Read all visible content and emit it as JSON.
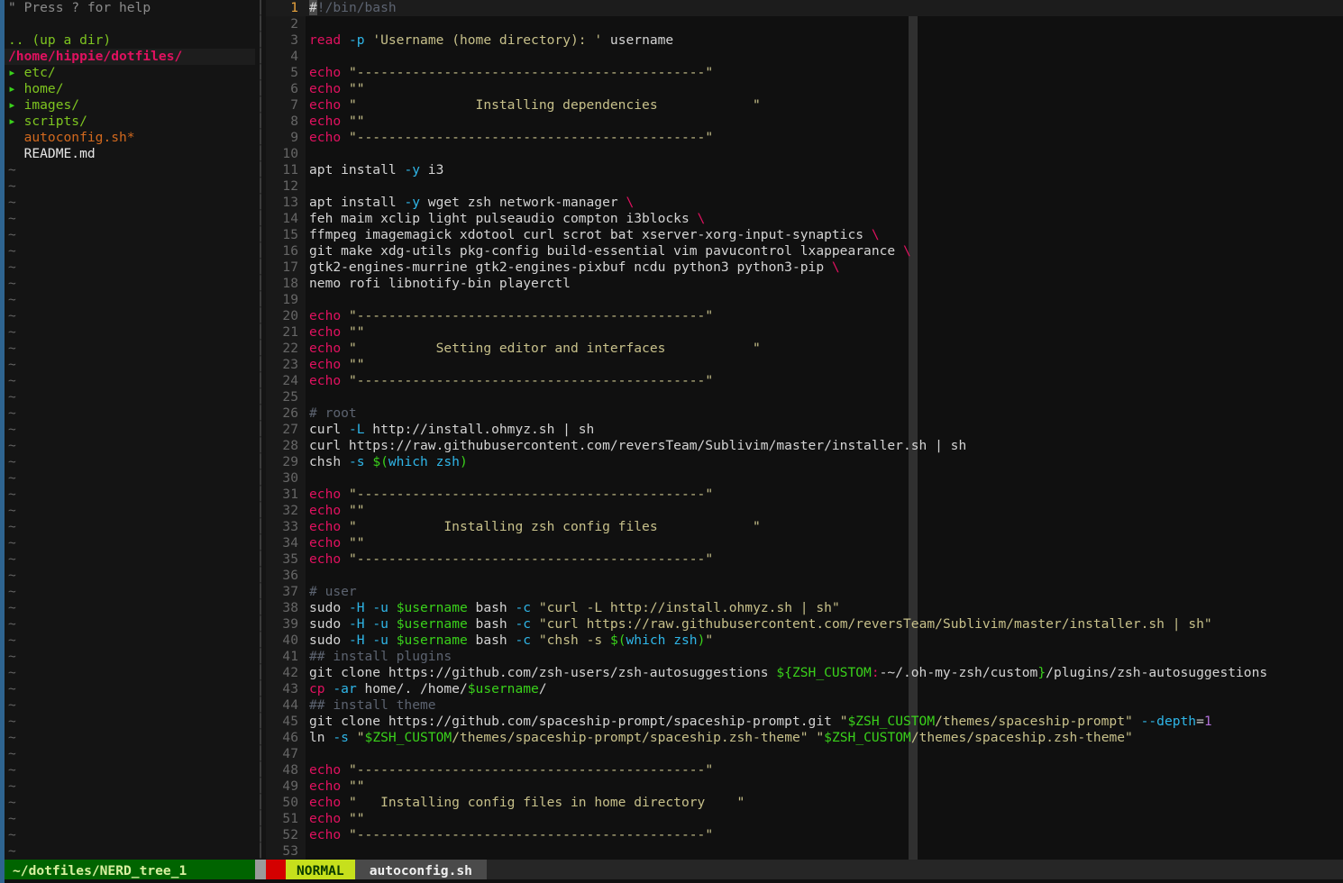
{
  "app": {
    "name": "vim",
    "colors": {
      "background": "#101010",
      "gutter_bg": "#191919",
      "cursorline_bg": "#1c1c1c",
      "colorcolumn": "#303030",
      "keyword_pink": "#e0115f",
      "string_khaki": "#c7c08a",
      "variable_green": "#3ad11b",
      "option_blue": "#2fb6e8",
      "comment_grey": "#5c6370",
      "number_purple": "#b06fd8",
      "status_mode_bg": "#c6e01c",
      "status_nerd_bg": "#006400",
      "window_border_blue": "#2e6490"
    }
  },
  "nerdtree": {
    "help_hint": "\" Press ? for help",
    "blank": "",
    "up_dir": ".. (up a dir)",
    "cwd": "/home/hippie/dotfiles/",
    "entries": [
      {
        "arrow": "▸",
        "label": "etc/",
        "type": "dir"
      },
      {
        "arrow": "▸",
        "label": "home/",
        "type": "dir"
      },
      {
        "arrow": "▸",
        "label": "images/",
        "type": "dir"
      },
      {
        "arrow": "▸",
        "label": "scripts/",
        "type": "dir"
      },
      {
        "arrow": " ",
        "label": "autoconfig.sh*",
        "type": "exec"
      },
      {
        "arrow": " ",
        "label": "README.md",
        "type": "file"
      }
    ],
    "filler_char": "~",
    "filler_count": 44
  },
  "split": {
    "separator_char": "│",
    "rows": 53
  },
  "editor": {
    "filename": "autoconfig.sh",
    "cursor_line": 1,
    "colorcolumn_at": 80,
    "first_visible_line": 1,
    "lines": [
      {
        "n": 1,
        "tokens": [
          {
            "t": "#",
            "c": "cursorblk"
          },
          {
            "t": "!/bin/bash",
            "c": "c-cmt"
          }
        ]
      },
      {
        "n": 2,
        "tokens": []
      },
      {
        "n": 3,
        "tokens": [
          {
            "t": "read",
            "c": "c-kw"
          },
          {
            "t": " ",
            "c": "c-id"
          },
          {
            "t": "-p",
            "c": "c-opt"
          },
          {
            "t": " ",
            "c": "c-id"
          },
          {
            "t": "'Username (home directory): '",
            "c": "c-str"
          },
          {
            "t": " username",
            "c": "c-id"
          }
        ]
      },
      {
        "n": 4,
        "tokens": []
      },
      {
        "n": 5,
        "tokens": [
          {
            "t": "echo",
            "c": "c-kw"
          },
          {
            "t": " ",
            "c": "c-id"
          },
          {
            "t": "\"--------------------------------------------\"",
            "c": "c-str"
          }
        ]
      },
      {
        "n": 6,
        "tokens": [
          {
            "t": "echo",
            "c": "c-kw"
          },
          {
            "t": " ",
            "c": "c-id"
          },
          {
            "t": "\"\"",
            "c": "c-str"
          }
        ]
      },
      {
        "n": 7,
        "tokens": [
          {
            "t": "echo",
            "c": "c-kw"
          },
          {
            "t": " ",
            "c": "c-id"
          },
          {
            "t": "\"               Installing dependencies            \"",
            "c": "c-str"
          }
        ]
      },
      {
        "n": 8,
        "tokens": [
          {
            "t": "echo",
            "c": "c-kw"
          },
          {
            "t": " ",
            "c": "c-id"
          },
          {
            "t": "\"\"",
            "c": "c-str"
          }
        ]
      },
      {
        "n": 9,
        "tokens": [
          {
            "t": "echo",
            "c": "c-kw"
          },
          {
            "t": " ",
            "c": "c-id"
          },
          {
            "t": "\"--------------------------------------------\"",
            "c": "c-str"
          }
        ]
      },
      {
        "n": 10,
        "tokens": []
      },
      {
        "n": 11,
        "tokens": [
          {
            "t": "apt install ",
            "c": "c-id"
          },
          {
            "t": "-y",
            "c": "c-opt"
          },
          {
            "t": " i3",
            "c": "c-id"
          }
        ]
      },
      {
        "n": 12,
        "tokens": []
      },
      {
        "n": 13,
        "tokens": [
          {
            "t": "apt install ",
            "c": "c-id"
          },
          {
            "t": "-y",
            "c": "c-opt"
          },
          {
            "t": " wget zsh network-manager ",
            "c": "c-id"
          },
          {
            "t": "\\",
            "c": "c-kw"
          }
        ]
      },
      {
        "n": 14,
        "tokens": [
          {
            "t": "feh maim xclip light pulseaudio compton i3blocks ",
            "c": "c-id"
          },
          {
            "t": "\\",
            "c": "c-kw"
          }
        ]
      },
      {
        "n": 15,
        "tokens": [
          {
            "t": "ffmpeg imagemagick xdotool curl scrot bat xserver-xorg-input-synaptics ",
            "c": "c-id"
          },
          {
            "t": "\\",
            "c": "c-kw"
          }
        ]
      },
      {
        "n": 16,
        "tokens": [
          {
            "t": "git make xdg-utils pkg-config build-essential vim pavucontrol lxappearance ",
            "c": "c-id"
          },
          {
            "t": "\\",
            "c": "c-kw"
          }
        ]
      },
      {
        "n": 17,
        "tokens": [
          {
            "t": "gtk2-engines-murrine gtk2-engines-pixbuf ncdu python3 python3-pip ",
            "c": "c-id"
          },
          {
            "t": "\\",
            "c": "c-kw"
          }
        ]
      },
      {
        "n": 18,
        "tokens": [
          {
            "t": "nemo rofi libnotify-bin playerctl",
            "c": "c-id"
          }
        ]
      },
      {
        "n": 19,
        "tokens": []
      },
      {
        "n": 20,
        "tokens": [
          {
            "t": "echo",
            "c": "c-kw"
          },
          {
            "t": " ",
            "c": "c-id"
          },
          {
            "t": "\"--------------------------------------------\"",
            "c": "c-str"
          }
        ]
      },
      {
        "n": 21,
        "tokens": [
          {
            "t": "echo",
            "c": "c-kw"
          },
          {
            "t": " ",
            "c": "c-id"
          },
          {
            "t": "\"\"",
            "c": "c-str"
          }
        ]
      },
      {
        "n": 22,
        "tokens": [
          {
            "t": "echo",
            "c": "c-kw"
          },
          {
            "t": " ",
            "c": "c-id"
          },
          {
            "t": "\"          Setting editor and interfaces           \"",
            "c": "c-str"
          }
        ]
      },
      {
        "n": 23,
        "tokens": [
          {
            "t": "echo",
            "c": "c-kw"
          },
          {
            "t": " ",
            "c": "c-id"
          },
          {
            "t": "\"\"",
            "c": "c-str"
          }
        ]
      },
      {
        "n": 24,
        "tokens": [
          {
            "t": "echo",
            "c": "c-kw"
          },
          {
            "t": " ",
            "c": "c-id"
          },
          {
            "t": "\"--------------------------------------------\"",
            "c": "c-str"
          }
        ]
      },
      {
        "n": 25,
        "tokens": []
      },
      {
        "n": 26,
        "tokens": [
          {
            "t": "# root",
            "c": "c-cmt"
          }
        ]
      },
      {
        "n": 27,
        "tokens": [
          {
            "t": "curl ",
            "c": "c-id"
          },
          {
            "t": "-L",
            "c": "c-opt"
          },
          {
            "t": " http://install.ohmyz.sh | sh",
            "c": "c-id"
          }
        ]
      },
      {
        "n": 28,
        "tokens": [
          {
            "t": "curl https://raw.githubusercontent.com/reversTeam/Sublivim/master/installer.sh | sh",
            "c": "c-id"
          }
        ]
      },
      {
        "n": 29,
        "tokens": [
          {
            "t": "chsh ",
            "c": "c-id"
          },
          {
            "t": "-s",
            "c": "c-opt"
          },
          {
            "t": " ",
            "c": "c-id"
          },
          {
            "t": "$(",
            "c": "c-var"
          },
          {
            "t": "which zsh",
            "c": "c-opt"
          },
          {
            "t": ")",
            "c": "c-var"
          }
        ]
      },
      {
        "n": 30,
        "tokens": []
      },
      {
        "n": 31,
        "tokens": [
          {
            "t": "echo",
            "c": "c-kw"
          },
          {
            "t": " ",
            "c": "c-id"
          },
          {
            "t": "\"--------------------------------------------\"",
            "c": "c-str"
          }
        ]
      },
      {
        "n": 32,
        "tokens": [
          {
            "t": "echo",
            "c": "c-kw"
          },
          {
            "t": " ",
            "c": "c-id"
          },
          {
            "t": "\"\"",
            "c": "c-str"
          }
        ]
      },
      {
        "n": 33,
        "tokens": [
          {
            "t": "echo",
            "c": "c-kw"
          },
          {
            "t": " ",
            "c": "c-id"
          },
          {
            "t": "\"           Installing zsh config files            \"",
            "c": "c-str"
          }
        ]
      },
      {
        "n": 34,
        "tokens": [
          {
            "t": "echo",
            "c": "c-kw"
          },
          {
            "t": " ",
            "c": "c-id"
          },
          {
            "t": "\"\"",
            "c": "c-str"
          }
        ]
      },
      {
        "n": 35,
        "tokens": [
          {
            "t": "echo",
            "c": "c-kw"
          },
          {
            "t": " ",
            "c": "c-id"
          },
          {
            "t": "\"--------------------------------------------\"",
            "c": "c-str"
          }
        ]
      },
      {
        "n": 36,
        "tokens": []
      },
      {
        "n": 37,
        "tokens": [
          {
            "t": "# user",
            "c": "c-cmt"
          }
        ]
      },
      {
        "n": 38,
        "tokens": [
          {
            "t": "sudo ",
            "c": "c-id"
          },
          {
            "t": "-H",
            "c": "c-opt"
          },
          {
            "t": " ",
            "c": "c-id"
          },
          {
            "t": "-u",
            "c": "c-opt"
          },
          {
            "t": " ",
            "c": "c-id"
          },
          {
            "t": "$username",
            "c": "c-var"
          },
          {
            "t": " bash ",
            "c": "c-id"
          },
          {
            "t": "-c",
            "c": "c-opt"
          },
          {
            "t": " ",
            "c": "c-id"
          },
          {
            "t": "\"curl -L http://install.ohmyz.sh | sh\"",
            "c": "c-str"
          }
        ]
      },
      {
        "n": 39,
        "tokens": [
          {
            "t": "sudo ",
            "c": "c-id"
          },
          {
            "t": "-H",
            "c": "c-opt"
          },
          {
            "t": " ",
            "c": "c-id"
          },
          {
            "t": "-u",
            "c": "c-opt"
          },
          {
            "t": " ",
            "c": "c-id"
          },
          {
            "t": "$username",
            "c": "c-var"
          },
          {
            "t": " bash ",
            "c": "c-id"
          },
          {
            "t": "-c",
            "c": "c-opt"
          },
          {
            "t": " ",
            "c": "c-id"
          },
          {
            "t": "\"curl https://raw.githubusercontent.com/reversTeam/Sublivim/master/installer.sh | sh\"",
            "c": "c-str"
          }
        ]
      },
      {
        "n": 40,
        "tokens": [
          {
            "t": "sudo ",
            "c": "c-id"
          },
          {
            "t": "-H",
            "c": "c-opt"
          },
          {
            "t": " ",
            "c": "c-id"
          },
          {
            "t": "-u",
            "c": "c-opt"
          },
          {
            "t": " ",
            "c": "c-id"
          },
          {
            "t": "$username",
            "c": "c-var"
          },
          {
            "t": " bash ",
            "c": "c-id"
          },
          {
            "t": "-c",
            "c": "c-opt"
          },
          {
            "t": " ",
            "c": "c-id"
          },
          {
            "t": "\"chsh -s ",
            "c": "c-str"
          },
          {
            "t": "$(",
            "c": "c-var"
          },
          {
            "t": "which zsh",
            "c": "c-opt"
          },
          {
            "t": ")",
            "c": "c-var"
          },
          {
            "t": "\"",
            "c": "c-str"
          }
        ]
      },
      {
        "n": 41,
        "tokens": [
          {
            "t": "## install plugins",
            "c": "c-cmt"
          }
        ]
      },
      {
        "n": 42,
        "tokens": [
          {
            "t": "git clone https://github.com/zsh-users/zsh-autosuggestions ",
            "c": "c-id"
          },
          {
            "t": "${ZSH_CUSTOM",
            "c": "c-var"
          },
          {
            "t": ":",
            "c": "c-colon"
          },
          {
            "t": "-~/.oh-my-zsh/custom",
            "c": "c-id"
          },
          {
            "t": "}",
            "c": "c-brace"
          },
          {
            "t": "/plugins/zsh-autosuggestions",
            "c": "c-id"
          }
        ]
      },
      {
        "n": 43,
        "tokens": [
          {
            "t": "cp",
            "c": "c-kw"
          },
          {
            "t": " ",
            "c": "c-id"
          },
          {
            "t": "-ar",
            "c": "c-opt"
          },
          {
            "t": " home/. /home/",
            "c": "c-id"
          },
          {
            "t": "$username",
            "c": "c-var"
          },
          {
            "t": "/",
            "c": "c-id"
          }
        ]
      },
      {
        "n": 44,
        "tokens": [
          {
            "t": "## install theme",
            "c": "c-cmt"
          }
        ]
      },
      {
        "n": 45,
        "tokens": [
          {
            "t": "git clone https://github.com/spaceship-prompt/spaceship-prompt.git ",
            "c": "c-id"
          },
          {
            "t": "\"",
            "c": "c-str"
          },
          {
            "t": "$ZSH_CUSTOM",
            "c": "c-var"
          },
          {
            "t": "/themes/spaceship-prompt\"",
            "c": "c-str"
          },
          {
            "t": " ",
            "c": "c-id"
          },
          {
            "t": "--depth",
            "c": "c-opt"
          },
          {
            "t": "=",
            "c": "c-id"
          },
          {
            "t": "1",
            "c": "c-num"
          }
        ]
      },
      {
        "n": 46,
        "tokens": [
          {
            "t": "ln ",
            "c": "c-id"
          },
          {
            "t": "-s",
            "c": "c-opt"
          },
          {
            "t": " ",
            "c": "c-id"
          },
          {
            "t": "\"",
            "c": "c-str"
          },
          {
            "t": "$ZSH_CUSTOM",
            "c": "c-var"
          },
          {
            "t": "/themes/spaceship-prompt/spaceship.zsh-theme\"",
            "c": "c-str"
          },
          {
            "t": " ",
            "c": "c-id"
          },
          {
            "t": "\"",
            "c": "c-str"
          },
          {
            "t": "$ZSH_CUSTOM",
            "c": "c-var"
          },
          {
            "t": "/themes/spaceship.zsh-theme\"",
            "c": "c-str"
          }
        ]
      },
      {
        "n": 47,
        "tokens": []
      },
      {
        "n": 48,
        "tokens": [
          {
            "t": "echo",
            "c": "c-kw"
          },
          {
            "t": " ",
            "c": "c-id"
          },
          {
            "t": "\"--------------------------------------------\"",
            "c": "c-str"
          }
        ]
      },
      {
        "n": 49,
        "tokens": [
          {
            "t": "echo",
            "c": "c-kw"
          },
          {
            "t": " ",
            "c": "c-id"
          },
          {
            "t": "\"\"",
            "c": "c-str"
          }
        ]
      },
      {
        "n": 50,
        "tokens": [
          {
            "t": "echo",
            "c": "c-kw"
          },
          {
            "t": " ",
            "c": "c-id"
          },
          {
            "t": "\"   Installing config files in home directory    \"",
            "c": "c-str"
          }
        ]
      },
      {
        "n": 51,
        "tokens": [
          {
            "t": "echo",
            "c": "c-kw"
          },
          {
            "t": " ",
            "c": "c-id"
          },
          {
            "t": "\"\"",
            "c": "c-str"
          }
        ]
      },
      {
        "n": 52,
        "tokens": [
          {
            "t": "echo",
            "c": "c-kw"
          },
          {
            "t": " ",
            "c": "c-id"
          },
          {
            "t": "\"--------------------------------------------\"",
            "c": "c-str"
          }
        ]
      },
      {
        "n": 53,
        "tokens": []
      }
    ]
  },
  "statusline": {
    "nerdtree_label": "~/dotfiles/NERD_tree_1",
    "mode": "NORMAL",
    "filename": "autoconfig.sh"
  }
}
